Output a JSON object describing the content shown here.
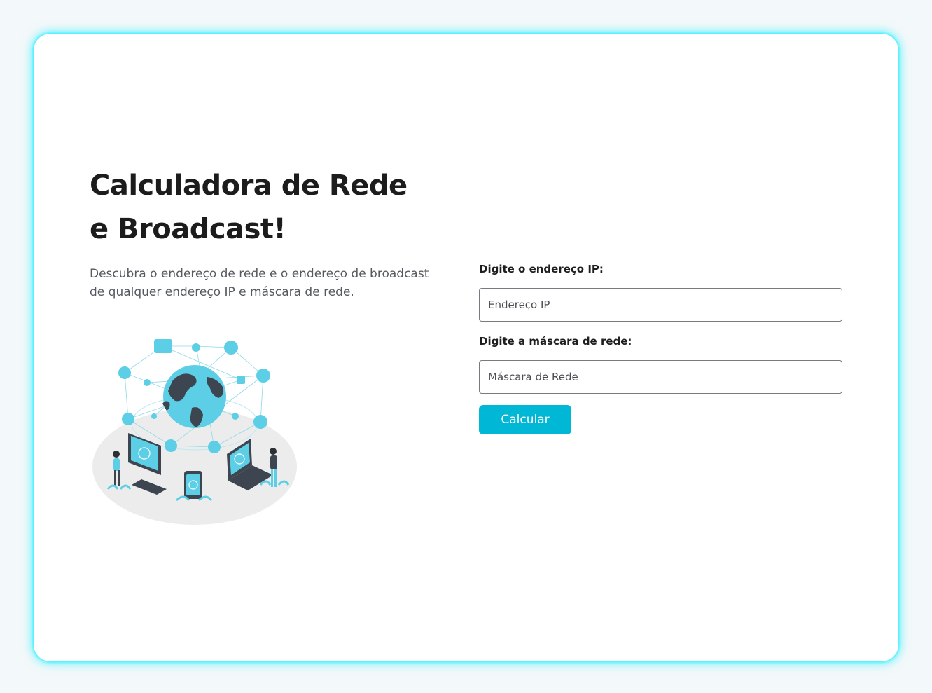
{
  "hero": {
    "title_line1": "Calculadora de Rede",
    "title_line2": "e Broadcast!",
    "subtitle": "Descubra o endereço de rede e o endereço de broadcast de qualquer endereço IP e máscara de rede."
  },
  "form": {
    "ip_label": "Digite o endereço IP:",
    "ip_placeholder": "Endereço IP",
    "mask_label": "Digite a máscara de rede:",
    "mask_placeholder": "Máscara de Rede",
    "submit_label": "Calcular"
  },
  "colors": {
    "accent": "#00b8d6",
    "card_glow": "#00eeff",
    "page_background": "#f3f8fa"
  }
}
